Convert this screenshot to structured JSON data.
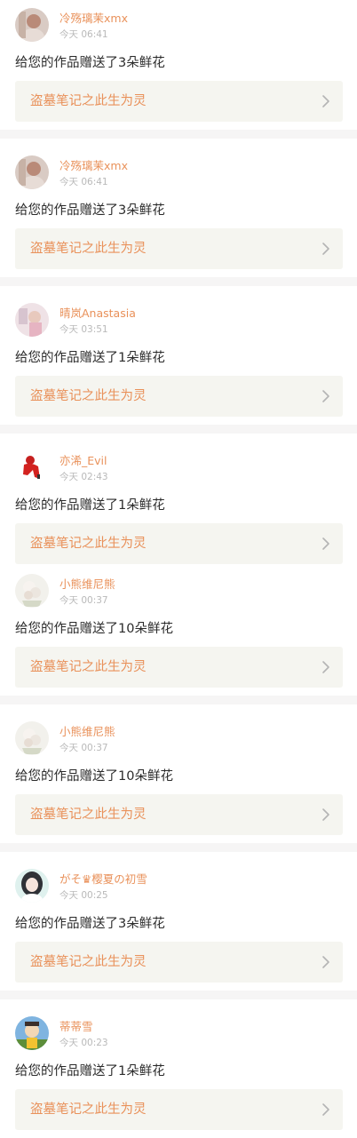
{
  "colors": {
    "accent": "#e9915a",
    "time": "#b9b9b9",
    "text": "#2b2b2b",
    "work_bg": "#f5f5f0",
    "separator": "#f6f5f5"
  },
  "notifications": [
    {
      "user": "冷殇璃茉xmx",
      "time": "今天 06:41",
      "message": "给您的作品赠送了3朵鲜花",
      "work_title": "盗墓笔记之此生为灵",
      "avatar": "avatar-girl-beige-icon",
      "chevron": "chevron-right-icon"
    },
    {
      "user": "冷殇璃茉xmx",
      "time": "今天 06:41",
      "message": "给您的作品赠送了3朵鲜花",
      "work_title": "盗墓笔记之此生为灵",
      "avatar": "avatar-girl-beige-icon",
      "chevron": "chevron-right-icon"
    },
    {
      "user": "晴岚Anastasia",
      "time": "今天 03:51",
      "message": "给您的作品赠送了1朵鲜花",
      "work_title": "盗墓笔记之此生为灵",
      "avatar": "avatar-girl-pink-icon",
      "chevron": "chevron-right-icon"
    },
    {
      "user": "亦浠_Evil",
      "time": "今天 02:43",
      "message": "给您的作品赠送了1朵鲜花",
      "work_title": "盗墓笔记之此生为灵",
      "avatar": "avatar-red-figure-icon",
      "chevron": "chevron-right-icon"
    },
    {
      "user": "小熊维尼熊",
      "time": "今天 00:37",
      "message": "给您的作品赠送了10朵鲜花",
      "work_title": "盗墓笔记之此生为灵",
      "avatar": "avatar-flower-icon",
      "chevron": "chevron-right-icon"
    },
    {
      "user": "小熊维尼熊",
      "time": "今天 00:37",
      "message": "给您的作品赠送了10朵鲜花",
      "work_title": "盗墓笔记之此生为灵",
      "avatar": "avatar-flower-icon",
      "chevron": "chevron-right-icon"
    },
    {
      "user": "がそ♛樱夏の初雪",
      "time": "今天 00:25",
      "message": "给您的作品赠送了3朵鲜花",
      "work_title": "盗墓笔记之此生为灵",
      "avatar": "avatar-anime-girl-icon",
      "chevron": "chevron-right-icon"
    },
    {
      "user": "蒂蒂雪",
      "time": "今天 00:23",
      "message": "给您的作品赠送了1朵鲜花",
      "work_title": "盗墓笔记之此生为灵",
      "avatar": "avatar-cartoon-icon",
      "chevron": "chevron-right-icon"
    }
  ]
}
